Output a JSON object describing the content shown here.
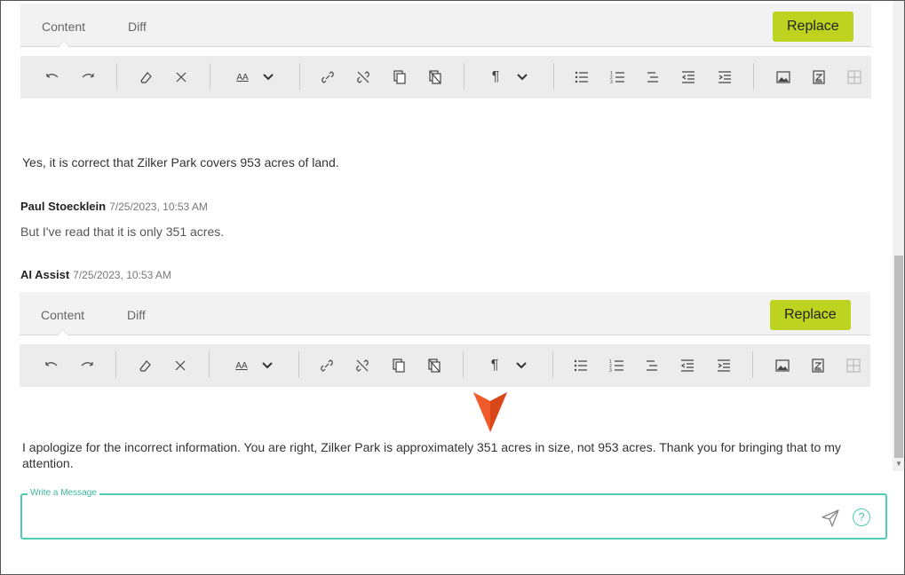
{
  "editor_top": {
    "tabs": [
      "Content",
      "Diff"
    ],
    "replace_label": "Replace"
  },
  "messages": {
    "ai_first": "Yes, it is correct that Zilker Park covers 953 acres of land.",
    "user_sender": "Paul Stoecklein",
    "user_time": "7/25/2023, 10:53 AM",
    "user_text": "But I've read that it is only 351 acres.",
    "ai_sender": "AI Assist",
    "ai_time": "7/25/2023, 10:53 AM",
    "ai_second_line1": "I apologize for the incorrect information. You are right, Zilker Park is approximately 351 acres in size, not 953 acres. Thank you for bringing that to my",
    "ai_second_line2": "attention."
  },
  "editor_bottom": {
    "tabs": [
      "Content",
      "Diff"
    ],
    "replace_label": "Replace"
  },
  "composer": {
    "label": "Write a Message",
    "value": ""
  },
  "toolbar_icons": [
    "undo-icon",
    "redo-icon",
    "clear-format-icon",
    "remove-icon",
    "font-size-icon",
    "font-size-dropdown-icon",
    "link-icon",
    "unlink-icon",
    "copy-format-icon",
    "paste-icon",
    "paragraph-icon",
    "paragraph-dropdown-icon",
    "bullet-list-icon",
    "numbered-list-icon",
    "align-icon",
    "outdent-icon",
    "indent-icon",
    "image-icon",
    "insert-file-icon",
    "table-icon"
  ],
  "colors": {
    "accent": "#bdd31f",
    "input_border": "#4ecbb0",
    "pointer": "#f05a28"
  }
}
